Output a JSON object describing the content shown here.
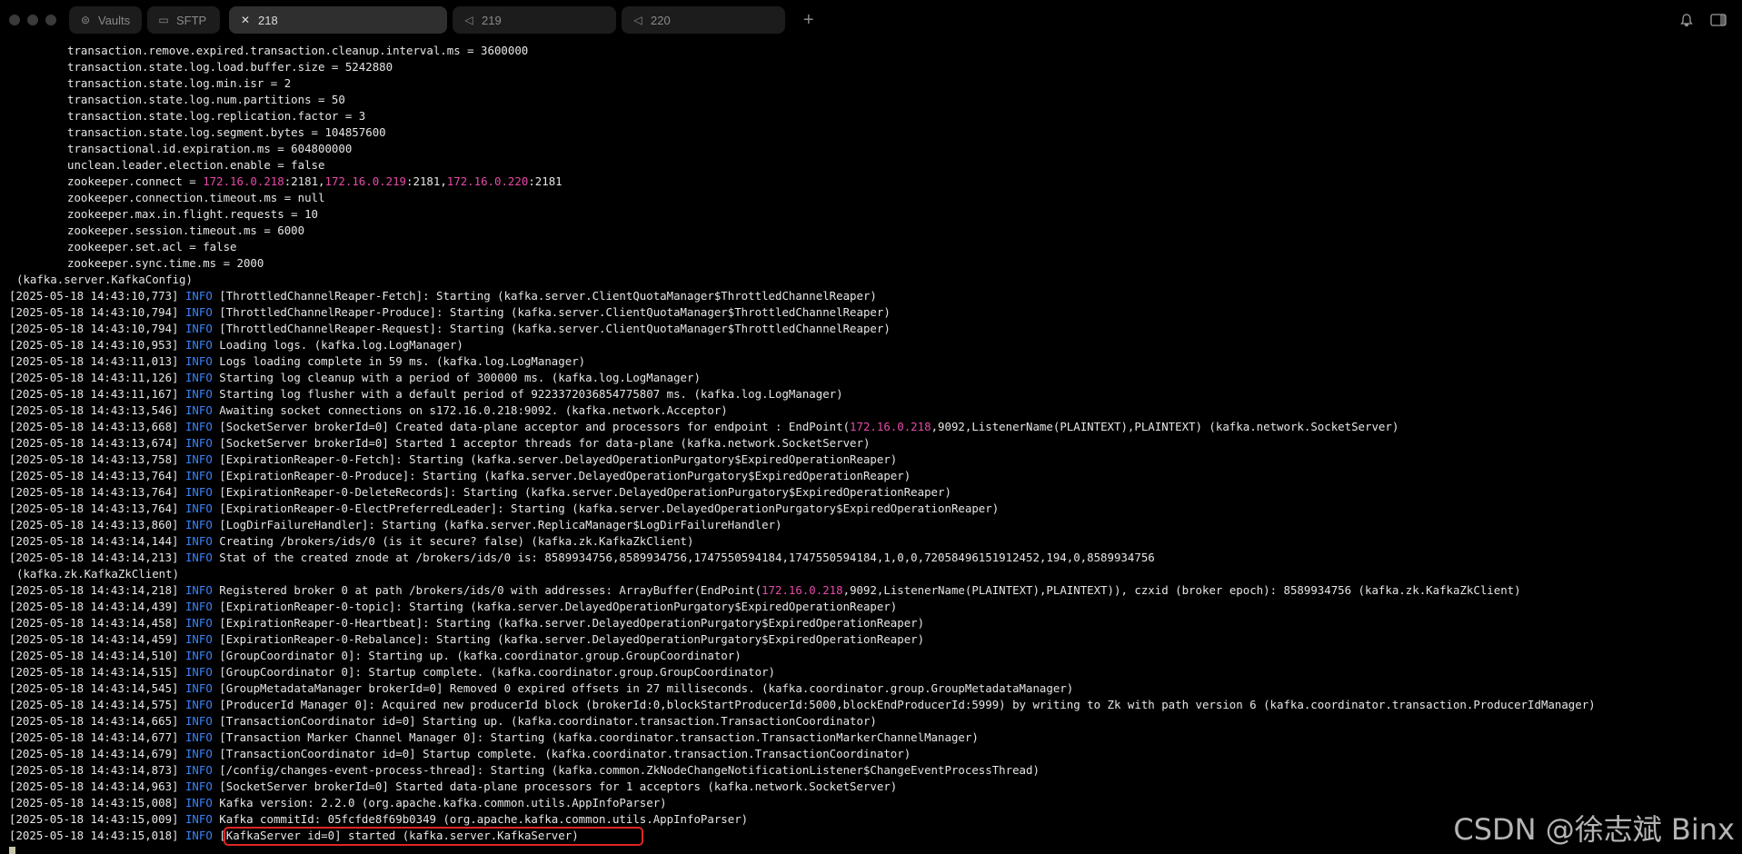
{
  "tabs": [
    {
      "label": "Vaults",
      "icon": "vault-icon",
      "active": false
    },
    {
      "label": "SFTP",
      "icon": "folder-icon",
      "active": false
    },
    {
      "label": "218",
      "icon": "close-icon",
      "active": true
    },
    {
      "label": "219",
      "icon": "terminal-icon",
      "active": false
    },
    {
      "label": "220",
      "icon": "terminal-icon",
      "active": false
    }
  ],
  "icons": {
    "new_tab": "plus-icon",
    "notifications": "bell-icon",
    "sidebar": "sidebar-icon"
  },
  "colors": {
    "info": "#3b82f6",
    "ip": "#e64aa8",
    "highlight_box": "#e02424"
  },
  "config_lines": [
    [
      {
        "t": "transaction.remove.expired.transaction.cleanup.interval.ms = 3600000"
      }
    ],
    [
      {
        "t": "transaction.state.log.load.buffer.size = 5242880"
      }
    ],
    [
      {
        "t": "transaction.state.log.min.isr = 2"
      }
    ],
    [
      {
        "t": "transaction.state.log.num.partitions = 50"
      }
    ],
    [
      {
        "t": "transaction.state.log.replication.factor = 3"
      }
    ],
    [
      {
        "t": "transaction.state.log.segment.bytes = 104857600"
      }
    ],
    [
      {
        "t": "transactional.id.expiration.ms = 604800000"
      }
    ],
    [
      {
        "t": "unclean.leader.election.enable = false"
      }
    ],
    [
      {
        "t": "zookeeper.connect = "
      },
      {
        "t": "172.16.0.218",
        "c": "ip"
      },
      {
        "t": ":2181,"
      },
      {
        "t": "172.16.0.219",
        "c": "ip"
      },
      {
        "t": ":2181,"
      },
      {
        "t": "172.16.0.220",
        "c": "ip"
      },
      {
        "t": ":2181"
      }
    ],
    [
      {
        "t": "zookeeper.connection.timeout.ms = null"
      }
    ],
    [
      {
        "t": "zookeeper.max.in.flight.requests = 10"
      }
    ],
    [
      {
        "t": "zookeeper.session.timeout.ms = 6000"
      }
    ],
    [
      {
        "t": "zookeeper.set.acl = false"
      }
    ],
    [
      {
        "t": "zookeeper.sync.time.ms = 2000"
      }
    ]
  ],
  "config_class": "(kafka.server.KafkaConfig)",
  "log_lines": [
    {
      "ts": "[2025-05-18 14:43:10,773]",
      "lvl": "INFO",
      "msg": [
        {
          "t": "[ThrottledChannelReaper-Fetch]: Starting (kafka.server.ClientQuotaManager$ThrottledChannelReaper)"
        }
      ]
    },
    {
      "ts": "[2025-05-18 14:43:10,794]",
      "lvl": "INFO",
      "msg": [
        {
          "t": "[ThrottledChannelReaper-Produce]: Starting (kafka.server.ClientQuotaManager$ThrottledChannelReaper)"
        }
      ]
    },
    {
      "ts": "[2025-05-18 14:43:10,794]",
      "lvl": "INFO",
      "msg": [
        {
          "t": "[ThrottledChannelReaper-Request]: Starting (kafka.server.ClientQuotaManager$ThrottledChannelReaper)"
        }
      ]
    },
    {
      "ts": "[2025-05-18 14:43:10,953]",
      "lvl": "INFO",
      "msg": [
        {
          "t": "Loading logs. (kafka.log.LogManager)"
        }
      ]
    },
    {
      "ts": "[2025-05-18 14:43:11,013]",
      "lvl": "INFO",
      "msg": [
        {
          "t": "Logs loading complete in 59 ms. (kafka.log.LogManager)"
        }
      ]
    },
    {
      "ts": "[2025-05-18 14:43:11,126]",
      "lvl": "INFO",
      "msg": [
        {
          "t": "Starting log cleanup with a period of 300000 ms. (kafka.log.LogManager)"
        }
      ]
    },
    {
      "ts": "[2025-05-18 14:43:11,167]",
      "lvl": "INFO",
      "msg": [
        {
          "t": "Starting log flusher with a default period of 9223372036854775807 ms. (kafka.log.LogManager)"
        }
      ]
    },
    {
      "ts": "[2025-05-18 14:43:13,546]",
      "lvl": "INFO",
      "msg": [
        {
          "t": "Awaiting socket connections on s172.16.0.218:9092. (kafka.network.Acceptor)"
        }
      ]
    },
    {
      "ts": "[2025-05-18 14:43:13,668]",
      "lvl": "INFO",
      "msg": [
        {
          "t": "[SocketServer brokerId=0] Created data-plane acceptor and processors for endpoint : EndPoint("
        },
        {
          "t": "172.16.0.218",
          "c": "ip"
        },
        {
          "t": ",9092,ListenerName(PLAINTEXT),PLAINTEXT) (kafka.network.SocketServer)"
        }
      ]
    },
    {
      "ts": "[2025-05-18 14:43:13,674]",
      "lvl": "INFO",
      "msg": [
        {
          "t": "[SocketServer brokerId=0] Started 1 acceptor threads for data-plane (kafka.network.SocketServer)"
        }
      ]
    },
    {
      "ts": "[2025-05-18 14:43:13,758]",
      "lvl": "INFO",
      "msg": [
        {
          "t": "[ExpirationReaper-0-Fetch]: Starting (kafka.server.DelayedOperationPurgatory$ExpiredOperationReaper)"
        }
      ]
    },
    {
      "ts": "[2025-05-18 14:43:13,764]",
      "lvl": "INFO",
      "msg": [
        {
          "t": "[ExpirationReaper-0-Produce]: Starting (kafka.server.DelayedOperationPurgatory$ExpiredOperationReaper)"
        }
      ]
    },
    {
      "ts": "[2025-05-18 14:43:13,764]",
      "lvl": "INFO",
      "msg": [
        {
          "t": "[ExpirationReaper-0-DeleteRecords]: Starting (kafka.server.DelayedOperationPurgatory$ExpiredOperationReaper)"
        }
      ]
    },
    {
      "ts": "[2025-05-18 14:43:13,764]",
      "lvl": "INFO",
      "msg": [
        {
          "t": "[ExpirationReaper-0-ElectPreferredLeader]: Starting (kafka.server.DelayedOperationPurgatory$ExpiredOperationReaper)"
        }
      ]
    },
    {
      "ts": "[2025-05-18 14:43:13,860]",
      "lvl": "INFO",
      "msg": [
        {
          "t": "[LogDirFailureHandler]: Starting (kafka.server.ReplicaManager$LogDirFailureHandler)"
        }
      ]
    },
    {
      "ts": "[2025-05-18 14:43:14,144]",
      "lvl": "INFO",
      "msg": [
        {
          "t": "Creating /brokers/ids/0 (is it secure? false) (kafka.zk.KafkaZkClient)"
        }
      ]
    },
    {
      "ts": "[2025-05-18 14:43:14,213]",
      "lvl": "INFO",
      "msg": [
        {
          "t": "Stat of the created znode at /brokers/ids/0 is: 8589934756,8589934756,1747550594184,1747550594184,1,0,0,72058496151912452,194,0,8589934756"
        }
      ]
    },
    {
      "cont": "(kafka.zk.KafkaZkClient)"
    },
    {
      "ts": "[2025-05-18 14:43:14,218]",
      "lvl": "INFO",
      "msg": [
        {
          "t": "Registered broker 0 at path /brokers/ids/0 with addresses: ArrayBuffer(EndPoint("
        },
        {
          "t": "172.16.0.218",
          "c": "ip"
        },
        {
          "t": ",9092,ListenerName(PLAINTEXT),PLAINTEXT)), czxid (broker epoch): 8589934756 (kafka.zk.KafkaZkClient)"
        }
      ]
    },
    {
      "ts": "[2025-05-18 14:43:14,439]",
      "lvl": "INFO",
      "msg": [
        {
          "t": "[ExpirationReaper-0-topic]: Starting (kafka.server.DelayedOperationPurgatory$ExpiredOperationReaper)"
        }
      ]
    },
    {
      "ts": "[2025-05-18 14:43:14,458]",
      "lvl": "INFO",
      "msg": [
        {
          "t": "[ExpirationReaper-0-Heartbeat]: Starting (kafka.server.DelayedOperationPurgatory$ExpiredOperationReaper)"
        }
      ]
    },
    {
      "ts": "[2025-05-18 14:43:14,459]",
      "lvl": "INFO",
      "msg": [
        {
          "t": "[ExpirationReaper-0-Rebalance]: Starting (kafka.server.DelayedOperationPurgatory$ExpiredOperationReaper)"
        }
      ]
    },
    {
      "ts": "[2025-05-18 14:43:14,510]",
      "lvl": "INFO",
      "msg": [
        {
          "t": "[GroupCoordinator 0]: Starting up. (kafka.coordinator.group.GroupCoordinator)"
        }
      ]
    },
    {
      "ts": "[2025-05-18 14:43:14,515]",
      "lvl": "INFO",
      "msg": [
        {
          "t": "[GroupCoordinator 0]: Startup complete. (kafka.coordinator.group.GroupCoordinator)"
        }
      ]
    },
    {
      "ts": "[2025-05-18 14:43:14,545]",
      "lvl": "INFO",
      "msg": [
        {
          "t": "[GroupMetadataManager brokerId=0] Removed 0 expired offsets in 27 milliseconds. (kafka.coordinator.group.GroupMetadataManager)"
        }
      ]
    },
    {
      "ts": "[2025-05-18 14:43:14,575]",
      "lvl": "INFO",
      "msg": [
        {
          "t": "[ProducerId Manager 0]: Acquired new producerId block (brokerId:0,blockStartProducerId:5000,blockEndProducerId:5999) by writing to Zk with path version 6 (kafka.coordinator.transaction.ProducerIdManager)"
        }
      ]
    },
    {
      "ts": "[2025-05-18 14:43:14,665]",
      "lvl": "INFO",
      "msg": [
        {
          "t": "[TransactionCoordinator id=0] Starting up. (kafka.coordinator.transaction.TransactionCoordinator)"
        }
      ]
    },
    {
      "ts": "[2025-05-18 14:43:14,677]",
      "lvl": "INFO",
      "msg": [
        {
          "t": "[Transaction Marker Channel Manager 0]: Starting (kafka.coordinator.transaction.TransactionMarkerChannelManager)"
        }
      ]
    },
    {
      "ts": "[2025-05-18 14:43:14,679]",
      "lvl": "INFO",
      "msg": [
        {
          "t": "[TransactionCoordinator id=0] Startup complete. (kafka.coordinator.transaction.TransactionCoordinator)"
        }
      ]
    },
    {
      "ts": "[2025-05-18 14:43:14,873]",
      "lvl": "INFO",
      "msg": [
        {
          "t": "[/config/changes-event-process-thread]: Starting (kafka.common.ZkNodeChangeNotificationListener$ChangeEventProcessThread)"
        }
      ]
    },
    {
      "ts": "[2025-05-18 14:43:14,963]",
      "lvl": "INFO",
      "msg": [
        {
          "t": "[SocketServer brokerId=0] Started data-plane processors for 1 acceptors (kafka.network.SocketServer)"
        }
      ]
    },
    {
      "ts": "[2025-05-18 14:43:15,008]",
      "lvl": "INFO",
      "msg": [
        {
          "t": "Kafka version: 2.2.0 (org.apache.kafka.common.utils.AppInfoParser)"
        }
      ]
    },
    {
      "ts": "[2025-05-18 14:43:15,009]",
      "lvl": "INFO",
      "msg": [
        {
          "t": "Kafka commitId: 05fcfde8f69b0349 (org.apache.kafka.common.utils.AppInfoParser)"
        }
      ]
    },
    {
      "ts": "[2025-05-18 14:43:15,018]",
      "lvl": "INFO",
      "msg": [
        {
          "t": "[KafkaServer id=0] started (kafka.server.KafkaServer)"
        }
      ],
      "highlight": true
    }
  ],
  "watermark": "CSDN @徐志斌 Binx"
}
